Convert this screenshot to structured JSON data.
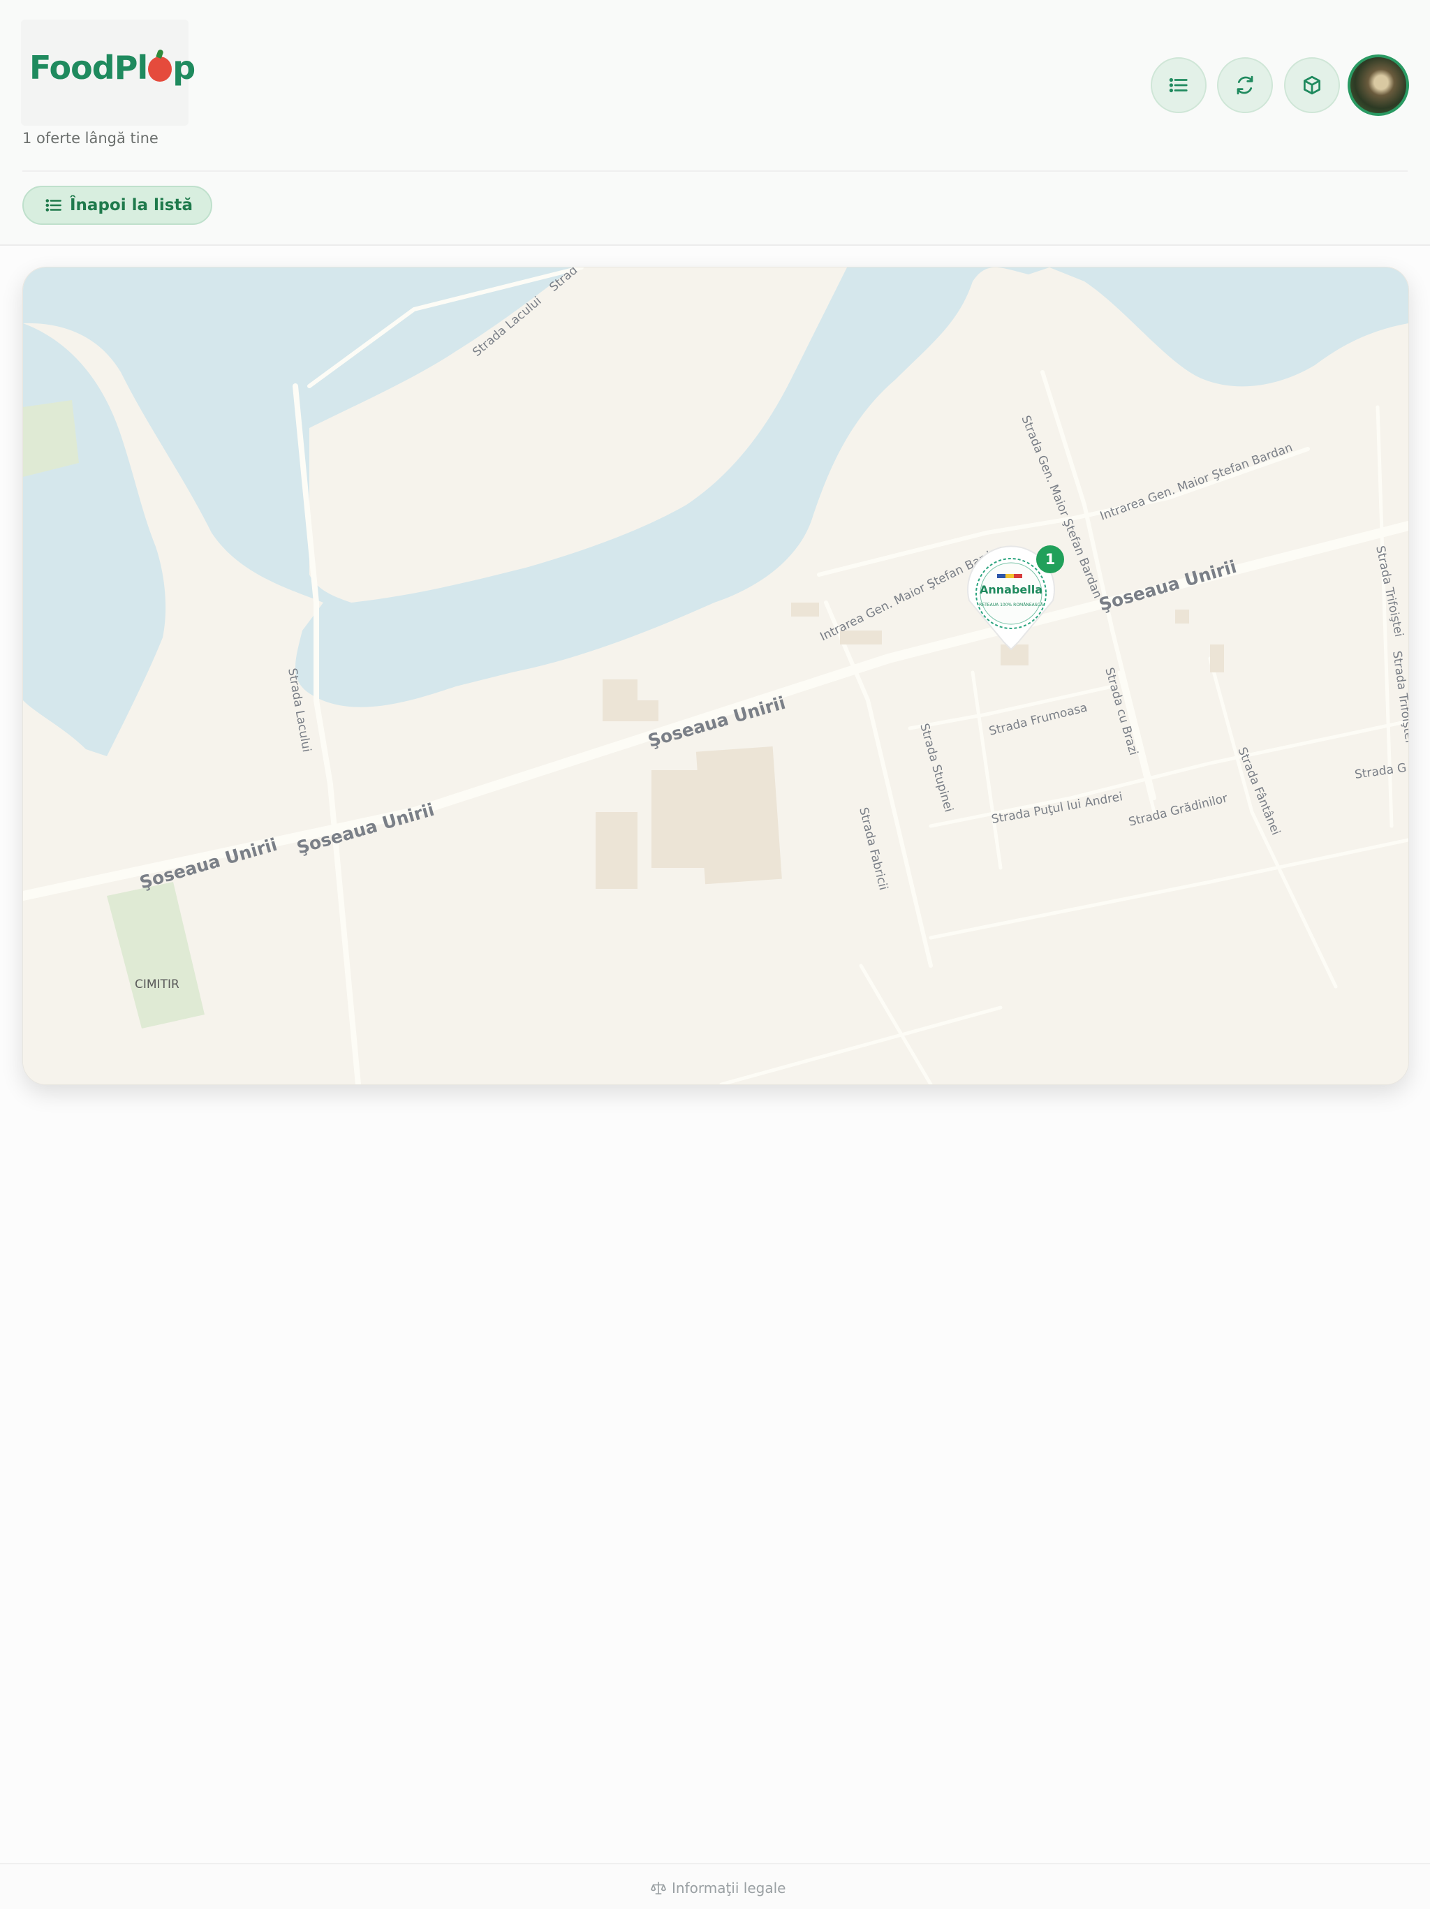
{
  "header": {
    "logo": {
      "text_before": "FoodPl",
      "text_after": "p"
    },
    "offers_count": "1 oferte lângă tine",
    "buttons": {
      "list_icon": "list-icon",
      "refresh_icon": "refresh-icon",
      "box_icon": "box-icon"
    },
    "back_button": {
      "label": "Înapoi la listă",
      "icon": "list-icon"
    }
  },
  "map": {
    "labels": {
      "soseaua": "Şoseaua Unirii",
      "strada_lacului": "Strada Lacului",
      "strada_lacului_top": "Strada Lacului",
      "strada_partial_top": "Strad",
      "intrarea_bardan_right": "Intrarea Gen. Maior Ştefan Bardan",
      "strada_bardan": "Strada Gen. Maior Ştefan Bardan",
      "intrarea_bardan_left": "Intrarea Gen. Maior Ştefan Bardan",
      "strada_frumoasa": "Strada Frumoasa",
      "strada_stupinei": "Strada Stupinei",
      "strada_cu_brazi": "Strada cu Brazi",
      "strada_putul": "Strada Puţul lui Andrei",
      "strada_gradinilor": "Strada Grădinilor",
      "strada_fantanei": "Strada Fântânei",
      "strada_fabricii": "Strada Fabricii",
      "strada_trifoistei": "Strada Trifoiştei",
      "strada_trifoistei_2": "Strada Trifoiştei",
      "strada_partial_right": "Strada G",
      "cimitir": "CIMITIR"
    },
    "marker": {
      "store_name": "Annabella",
      "tagline": "RETEAUA 100% ROMÂNEASCĂ",
      "count": "1",
      "badge_color": "#21a05a"
    }
  },
  "footer": {
    "legal_link": "Informaţii legale",
    "icon": "scales-icon"
  },
  "colors": {
    "accent": "#1f8a5e",
    "water": "#d5e7ec",
    "land": "#f6f3ec",
    "road": "#fdfcf6"
  }
}
